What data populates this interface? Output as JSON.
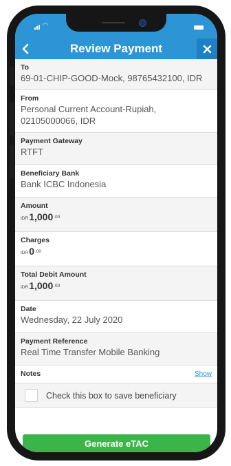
{
  "header": {
    "title": "Review Payment",
    "back_icon": "chevron-left-icon",
    "close_icon": "close-icon"
  },
  "theme": {
    "header_color": "#2d95d6",
    "cta_color": "#3bb54a",
    "link_color": "#2d95d6"
  },
  "fields": {
    "to": {
      "label": "To",
      "value": "69-01-CHIP-GOOD-Mock, 98765432100, IDR"
    },
    "from": {
      "label": "From",
      "value": "Personal Current Account-Rupiah, 02105000066, IDR"
    },
    "gateway": {
      "label": "Payment Gateway",
      "value": "RTFT"
    },
    "bank": {
      "label": "Beneficiary Bank",
      "value": "Bank ICBC Indonesia"
    },
    "amount": {
      "label": "Amount",
      "currency": "IDR",
      "integer": "1,000",
      "decimal": ".00"
    },
    "charges": {
      "label": "Charges",
      "currency": "IDR",
      "integer": "0",
      "decimal": ".00"
    },
    "total": {
      "label": "Total Debit Amount",
      "currency": "IDR",
      "integer": "1,000",
      "decimal": ".00"
    },
    "date": {
      "label": "Date",
      "value": "Wednesday, 22 July 2020"
    },
    "reference": {
      "label": "Payment Reference",
      "value": "Real Time Transfer Mobile Banking"
    }
  },
  "notes": {
    "label": "Notes",
    "link": "Show"
  },
  "save_beneficiary": {
    "label": "Check this box to save beneficiary",
    "checked": false
  },
  "cta": {
    "label": "Generate eTAC"
  }
}
